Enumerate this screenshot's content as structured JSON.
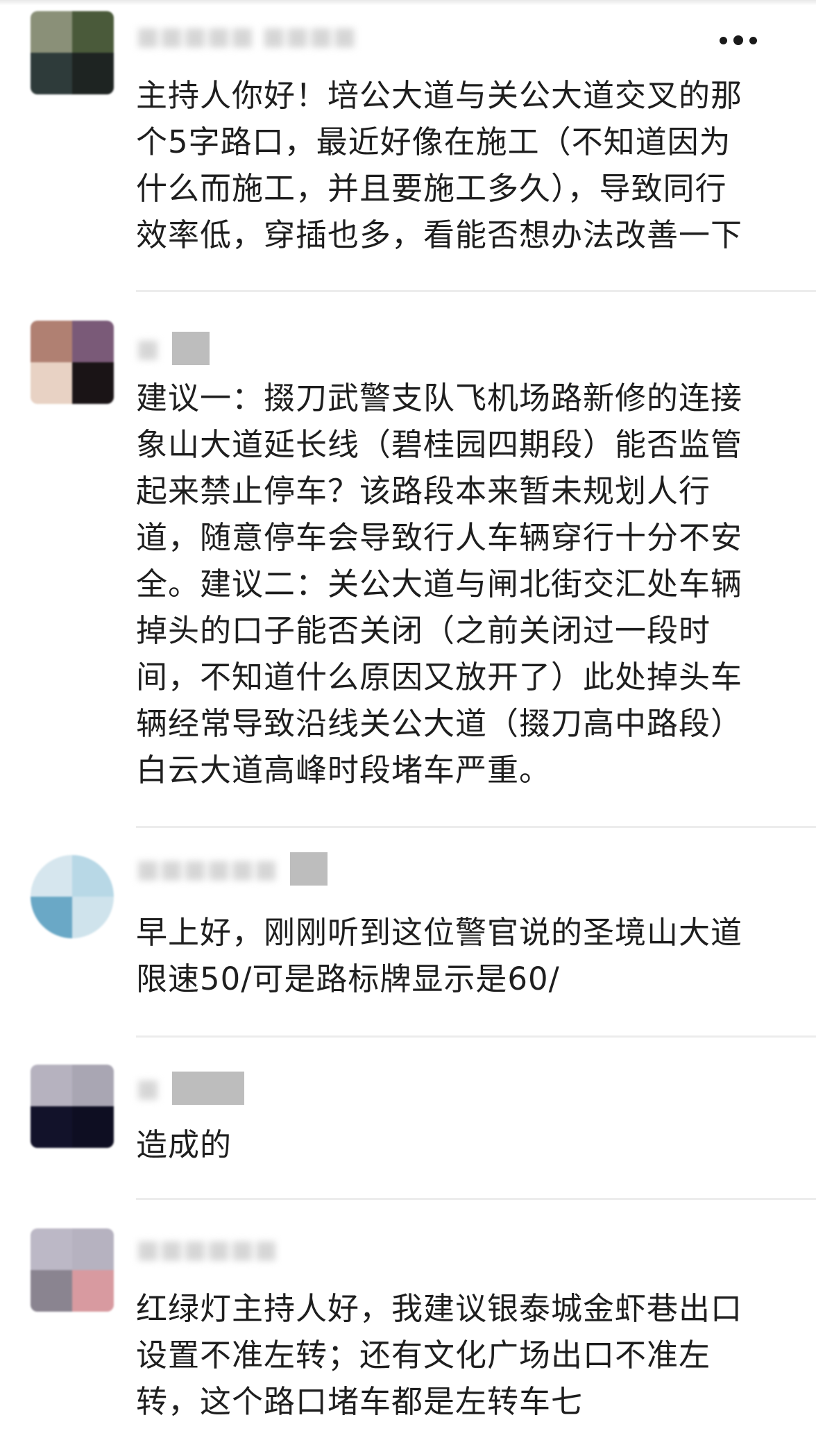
{
  "comments": [
    {
      "text": "主持人你好！培公大道与关公大道交叉的那\n个5字路口，最近好像在施工（不知道因为\n什么而施工，并且要施工多久），导致同行\n效率低，穿插也多，看能否想办法改善一下"
    },
    {
      "text": "建议一：掇刀武警支队飞机场路新修的连接\n象山大道延长线（碧桂园四期段）能否监管\n起来禁止停车？该路段本来暂未规划人行\n道，随意停车会导致行人车辆穿行十分不安\n全。建议二：关公大道与闸北街交汇处车辆\n掉头的口子能否关闭（之前关闭过一段时\n间，不知道什么原因又放开了）此处掉头车\n辆经常导致沿线关公大道（掇刀高中路段）\n白云大道高峰时段堵车严重。"
    },
    {
      "text": "早上好，刚刚听到这位警官说的圣境山大道\n限速50/可是路标牌显示是60/"
    },
    {
      "text": "造成的"
    },
    {
      "text": "红绿灯主持人好，我建议银泰城金虾巷出口\n设置不准左转；还有文化广场出口不准左\n转，这个路口堵车都是左转车七"
    }
  ],
  "more_icon": "more-dots-icon",
  "colors": {
    "text": "#1e1e1e",
    "divider": "#ececec",
    "background": "#ffffff"
  }
}
